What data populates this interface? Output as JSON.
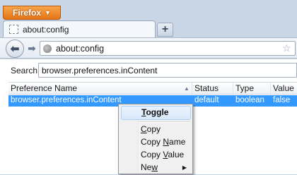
{
  "firefox_button": {
    "label": "Firefox",
    "caret": "▼"
  },
  "tabs": [
    {
      "title": "about:config"
    }
  ],
  "new_tab": {
    "label": "+"
  },
  "navigation": {
    "back": "⬅",
    "forward": "➡",
    "url": "about:config",
    "star": "☆"
  },
  "search": {
    "label": "Search:",
    "value": "browser.preferences.inContent"
  },
  "table": {
    "columns": [
      "Preference Name",
      "Status",
      "Type",
      "Value"
    ],
    "sort_indicator": "▲",
    "rows": [
      {
        "name": "browser.preferences.inContent",
        "status": "default",
        "type": "boolean",
        "value": "false"
      }
    ]
  },
  "context_menu": {
    "items": [
      {
        "label": "Toggle",
        "accel": "T",
        "rest": "oggle"
      },
      {
        "label": "Copy",
        "accel": "C",
        "rest": "opy"
      },
      {
        "label": "Copy Name",
        "pre": "Copy ",
        "accel": "N",
        "rest": "ame"
      },
      {
        "label": "Copy Value",
        "pre": "Copy ",
        "accel": "V",
        "rest": "alue"
      },
      {
        "label": "New",
        "pre": "Ne",
        "accel": "w",
        "rest": ""
      }
    ],
    "submenu_arrow": "▶"
  },
  "colors": {
    "selection": "#3399ff",
    "firefox_orange": "#e57617"
  }
}
